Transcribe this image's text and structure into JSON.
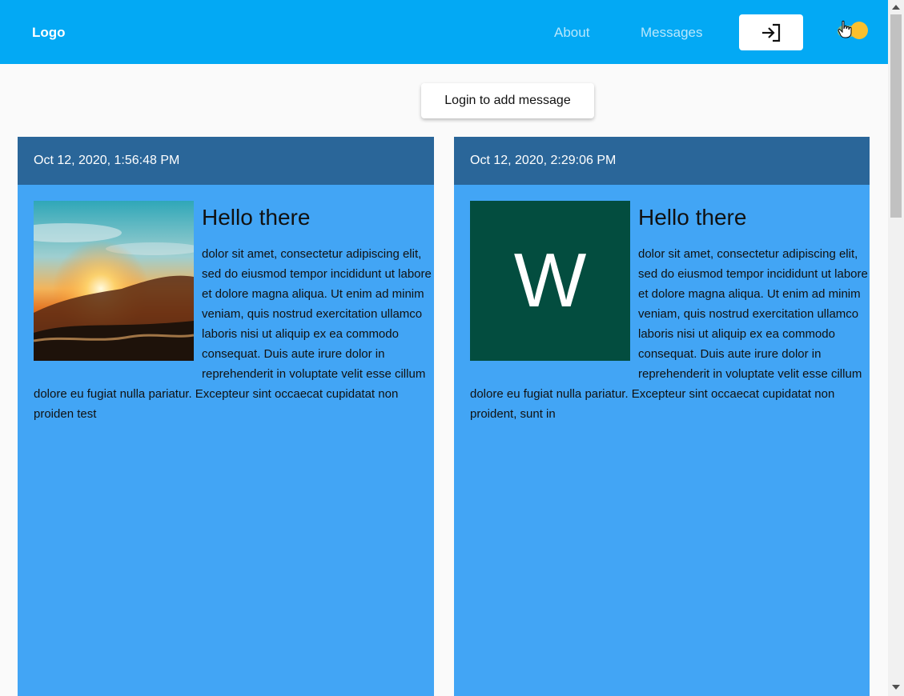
{
  "appbar": {
    "logo": "Logo",
    "nav": [
      {
        "label": "About"
      },
      {
        "label": "Messages"
      }
    ],
    "login_icon": "login-arrow-icon",
    "theme_toggle": {
      "state": "on",
      "color": "#fbc02d"
    },
    "background": "#03a9f4"
  },
  "actions": {
    "add_message_label": "Login to add message"
  },
  "messages": [
    {
      "timestamp": "Oct 12, 2020, 1:56:48 PM",
      "title": "Hello there",
      "image": "sunset-photo",
      "body": "dolor sit amet, consectetur adipiscing elit, sed do eiusmod tempor incididunt ut labore et dolore magna aliqua. Ut enim ad minim veniam, quis nostrud exercitation ullamco laboris nisi ut aliquip ex ea commodo consequat. Duis aute irure dolor in reprehenderit in voluptate velit esse cillum dolore eu fugiat nulla pariatur. Excepteur sint occaecat cupidatat non proiden test"
    },
    {
      "timestamp": "Oct 12, 2020, 2:29:06 PM",
      "title": "Hello there",
      "image": "avatar-letter",
      "avatar_letter": "W",
      "body": "dolor sit amet, consectetur adipiscing elit, sed do eiusmod tempor incididunt ut labore et dolore magna aliqua. Ut enim ad minim veniam, quis nostrud exercitation ullamco laboris nisi ut aliquip ex ea commodo consequat. Duis aute irure dolor in reprehenderit in voluptate velit esse cillum dolore eu fugiat nulla pariatur. Excepteur sint occaecat cupidatat non proident, sunt in"
    }
  ],
  "colors": {
    "card_background": "#42a5f5",
    "card_header": "#2a6699",
    "avatar_background": "#034d3f"
  }
}
